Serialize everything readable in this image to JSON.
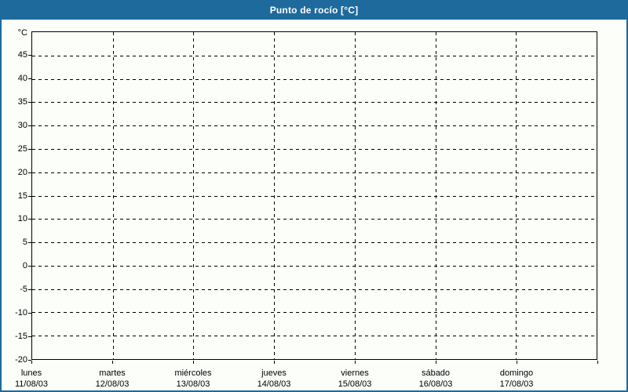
{
  "window": {
    "title": "Punto de rocío [°C]"
  },
  "colors": {
    "accent_blue": "#1e6a9d",
    "background": "#fcfefa",
    "grid_and_axis": "#000000",
    "title_text": "#ffffff",
    "label_text": "#000000"
  },
  "chart_data": {
    "type": "line",
    "title": "Punto de rocío [°C]",
    "xlabel": "",
    "ylabel": "°C",
    "grid": "dashed",
    "legend_position": "none",
    "y_axis": {
      "unit_label": "°C",
      "min": -20,
      "max": 50,
      "tick_step": 5,
      "tick_labels": [
        "45",
        "40",
        "35",
        "30",
        "25",
        "20",
        "15",
        "10",
        "5",
        "0",
        "-5",
        "-10",
        "-15",
        "-20"
      ]
    },
    "x_axis": {
      "categories": [
        {
          "day": "lunes",
          "date": "11/08/03"
        },
        {
          "day": "martes",
          "date": "12/08/03"
        },
        {
          "day": "miércoles",
          "date": "13/08/03"
        },
        {
          "day": "jueves",
          "date": "14/08/03"
        },
        {
          "day": "viernes",
          "date": "15/08/03"
        },
        {
          "day": "sábado",
          "date": "16/08/03"
        },
        {
          "day": "domingo",
          "date": "17/08/03"
        }
      ]
    },
    "series": []
  }
}
